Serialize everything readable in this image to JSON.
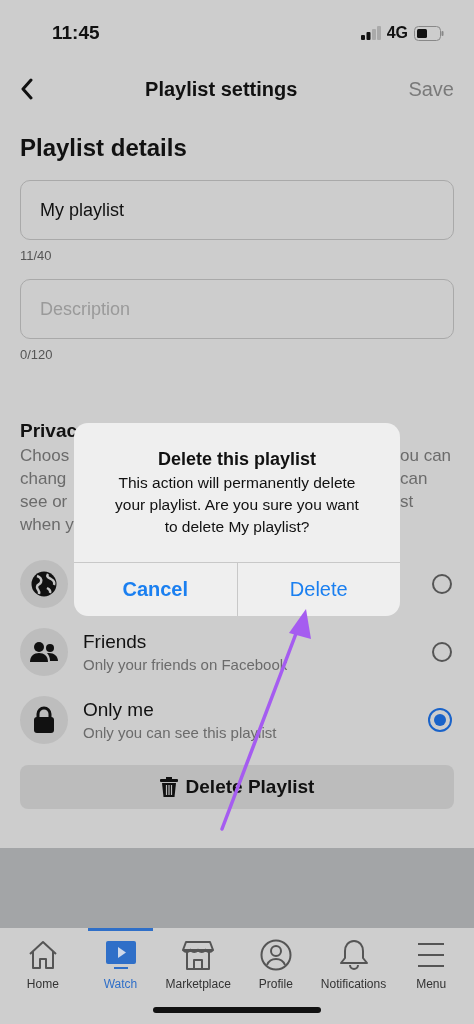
{
  "status_bar": {
    "time": "11:45",
    "network": "4G"
  },
  "header": {
    "title": "Playlist settings",
    "action": "Save"
  },
  "section_title": "Playlist details",
  "fields": [
    {
      "value": "My playlist",
      "counter": "11/40"
    },
    {
      "placeholder": "Description",
      "counter": "0/120"
    }
  ],
  "privacy": {
    "title": "Privac",
    "description_lines": [
      {
        "left": "Choos",
        "right": "ou can"
      },
      {
        "left": "chang",
        "right": "can"
      },
      {
        "left": "see or",
        "right": "st"
      },
      {
        "left": "when y"
      }
    ],
    "options": [
      {
        "kind": "globe",
        "selected": false
      },
      {
        "kind": "friends",
        "label": "Friends",
        "detail": "Only your friends on Facebook",
        "selected": false
      },
      {
        "kind": "lock",
        "label": "Only me",
        "detail": "Only you can see this playlist",
        "selected": true
      }
    ]
  },
  "delete_button": "Delete Playlist",
  "dialog": {
    "title": "Delete this playlist",
    "message": "This action will permanently delete your playlist. Are you sure you want to delete My playlist?",
    "buttons": [
      {
        "label": "Cancel",
        "kind": "cancel"
      },
      {
        "label": "Delete",
        "kind": "confirm"
      }
    ]
  },
  "tabs": [
    {
      "kind": "home",
      "label": "Home",
      "selected": false
    },
    {
      "kind": "watch",
      "label": "Watch",
      "selected": true
    },
    {
      "kind": "store",
      "label": "Marketplace",
      "selected": false
    },
    {
      "kind": "profile",
      "label": "Profile",
      "selected": false
    },
    {
      "kind": "bell",
      "label": "Notifications",
      "selected": false
    },
    {
      "kind": "menu",
      "label": "Menu",
      "selected": false
    }
  ]
}
